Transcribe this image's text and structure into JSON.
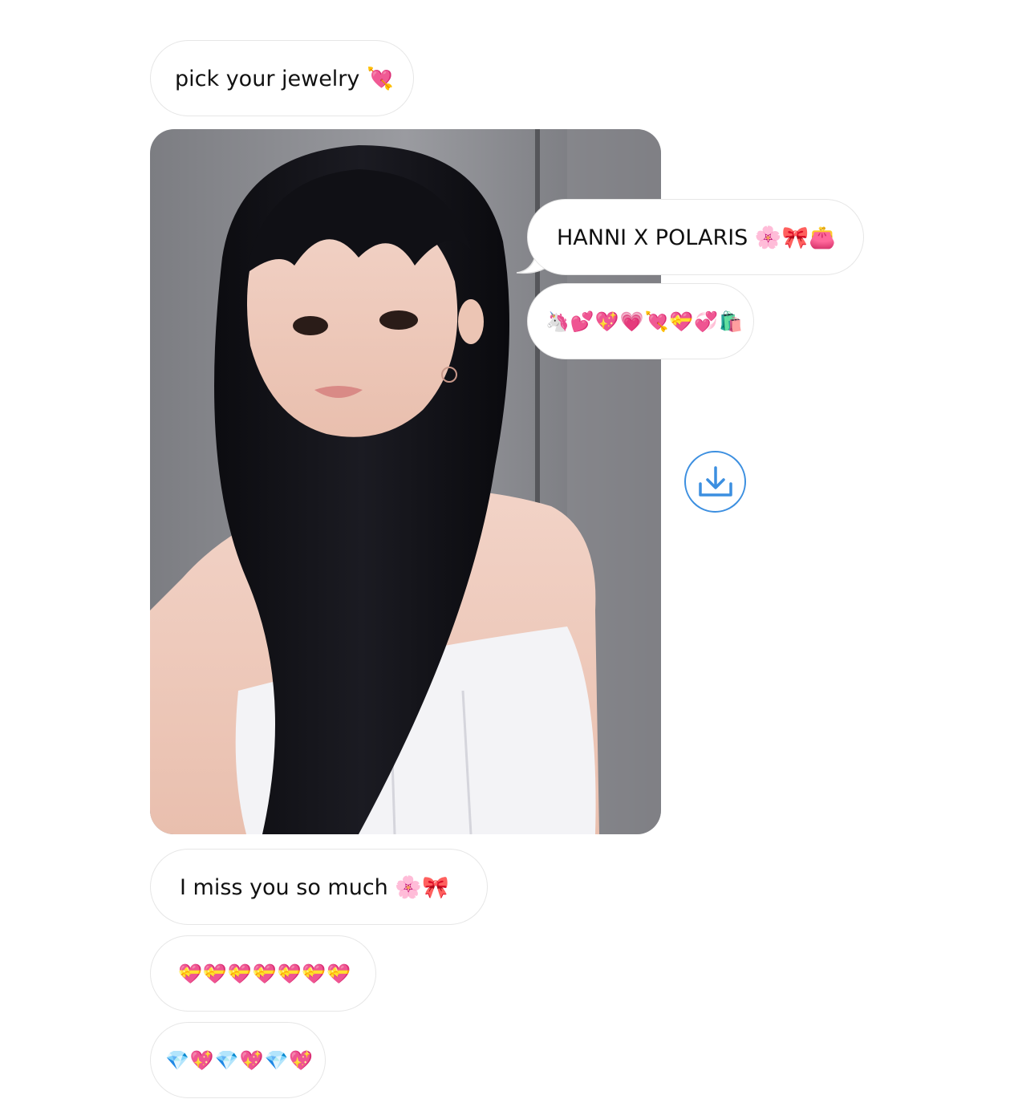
{
  "messages": {
    "m1": "pick your jewelry 💘",
    "m2": "HANNI X POLARIS 🌸🎀👛",
    "m3": "🦄💕💖💗💘💝💞🛍️",
    "m4": "I miss you so much  🌸🎀",
    "m5": "💝💝💝💝💝💝💝",
    "m6": "💎💖💎💖💎💖"
  },
  "icons": {
    "download": "download-icon"
  },
  "colors": {
    "accent": "#3c8fe0",
    "bubble_border": "#e6e6e6",
    "text": "#111111"
  }
}
